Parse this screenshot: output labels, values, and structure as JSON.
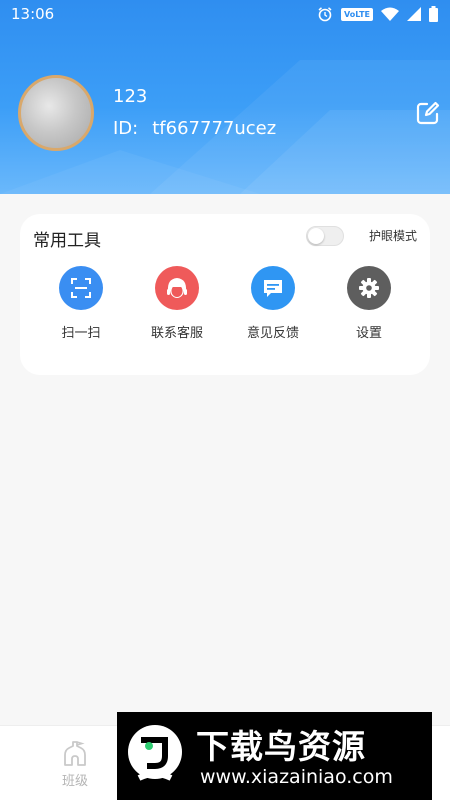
{
  "status_bar": {
    "time": "13:06",
    "volte": "VoLTE",
    "icons": [
      "alarm-icon",
      "volte-icon",
      "wifi-icon",
      "signal-icon",
      "battery-icon"
    ]
  },
  "profile": {
    "name": "123",
    "id_label": "ID:",
    "id_value": "tf667777ucez"
  },
  "tools_card": {
    "title": "常用工具",
    "eye_mode_label": "护眼模式",
    "eye_mode_on": false,
    "tools": [
      {
        "label": "扫一扫",
        "icon": "scan-icon",
        "color": "#3a8ef2"
      },
      {
        "label": "联系客服",
        "icon": "customer-service-icon",
        "color": "#ef5a5a"
      },
      {
        "label": "意见反馈",
        "icon": "feedback-icon",
        "color": "#2f96f3"
      },
      {
        "label": "设置",
        "icon": "gear-icon",
        "color": "#5e5e5e"
      }
    ]
  },
  "bottom_nav": {
    "items": [
      {
        "label": "班级",
        "icon": "class-icon"
      }
    ]
  },
  "watermark": {
    "title": "下载鸟资源",
    "url": "www.xiazainiao.com"
  },
  "colors": {
    "header_blue": "#2f8ef0",
    "card_bg": "#ffffff",
    "page_bg": "#f7f7f7"
  }
}
